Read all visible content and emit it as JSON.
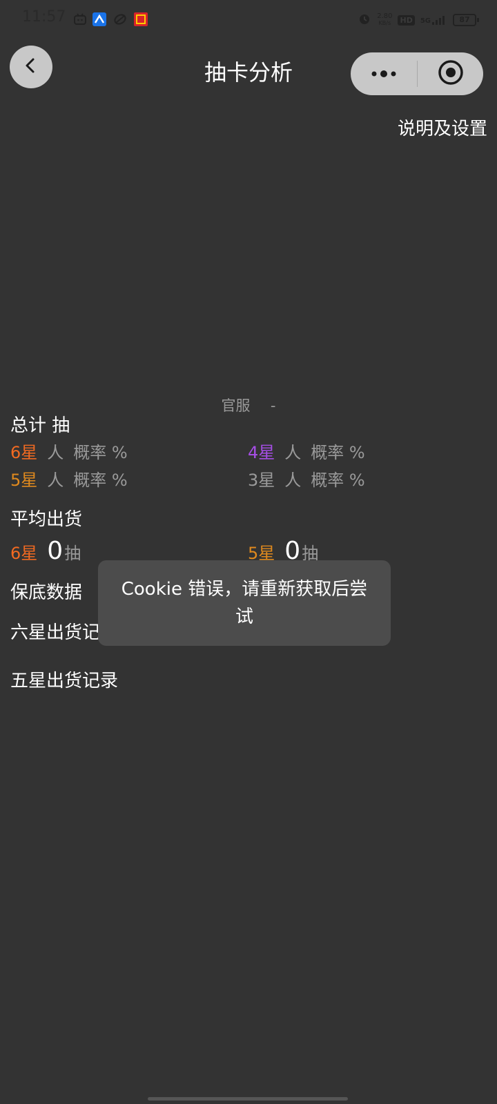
{
  "status_bar": {
    "time": "11:57",
    "net_speed_value": "2.80",
    "net_speed_unit": "KB/s",
    "hd_label": "HD",
    "signal_label": "5G",
    "battery": "87",
    "icons": [
      "bilibili-icon",
      "app-blue-icon",
      "app-swirl-icon",
      "taobao-icon",
      "alarm-icon",
      "signal-icon",
      "battery-icon"
    ]
  },
  "header": {
    "title": "抽卡分析",
    "back_icon": "chevron-left-icon",
    "more_icon": "more-dots-icon",
    "close_icon": "target-circle-icon"
  },
  "settings_link": "说明及设置",
  "server": {
    "label": "官服",
    "value": "-"
  },
  "summary": {
    "total_label": "总计 抽",
    "stars": [
      {
        "star": "6星",
        "people": "人",
        "rate": "概率 %",
        "color": "#f26a21"
      },
      {
        "star": "5星",
        "people": "人",
        "rate": "概率 %",
        "color": "#e08a1e"
      },
      {
        "star": "4星",
        "people": "人",
        "rate": "概率 %",
        "color": "#a64ee6"
      },
      {
        "star": "3星",
        "people": "人",
        "rate": "概率 %",
        "color": "#9a9a9a"
      }
    ]
  },
  "average": {
    "title": "平均出货",
    "six_star_label": "6星",
    "six_star_value": "0",
    "six_star_unit": "抽",
    "five_star_label": "5星",
    "five_star_value": "0",
    "five_star_unit": "抽"
  },
  "sections": {
    "pity": "保底数据",
    "six_star_records": "六星出货记",
    "five_star_records": "五星出货记录"
  },
  "toast": {
    "message": "Cookie 错误，请重新获取后尝试"
  }
}
